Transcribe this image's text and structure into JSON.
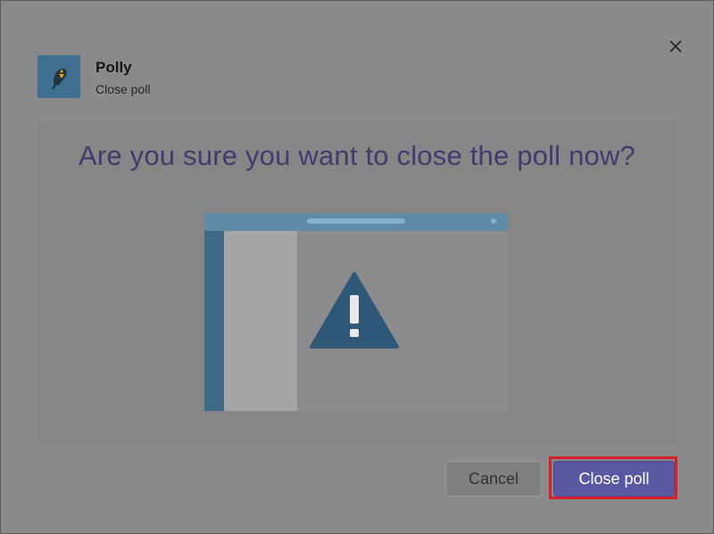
{
  "dialog": {
    "app_name": "Polly",
    "subtitle": "Close poll",
    "close_icon": "close-icon",
    "question": "Are you sure you want to close the poll now?",
    "illustration_icon": "warning-icon"
  },
  "buttons": {
    "cancel_label": "Cancel",
    "close_poll_label": "Close poll"
  },
  "colors": {
    "primary": "#5b58a2",
    "highlight": "#d4202a",
    "question_text": "#3f3c6e"
  }
}
